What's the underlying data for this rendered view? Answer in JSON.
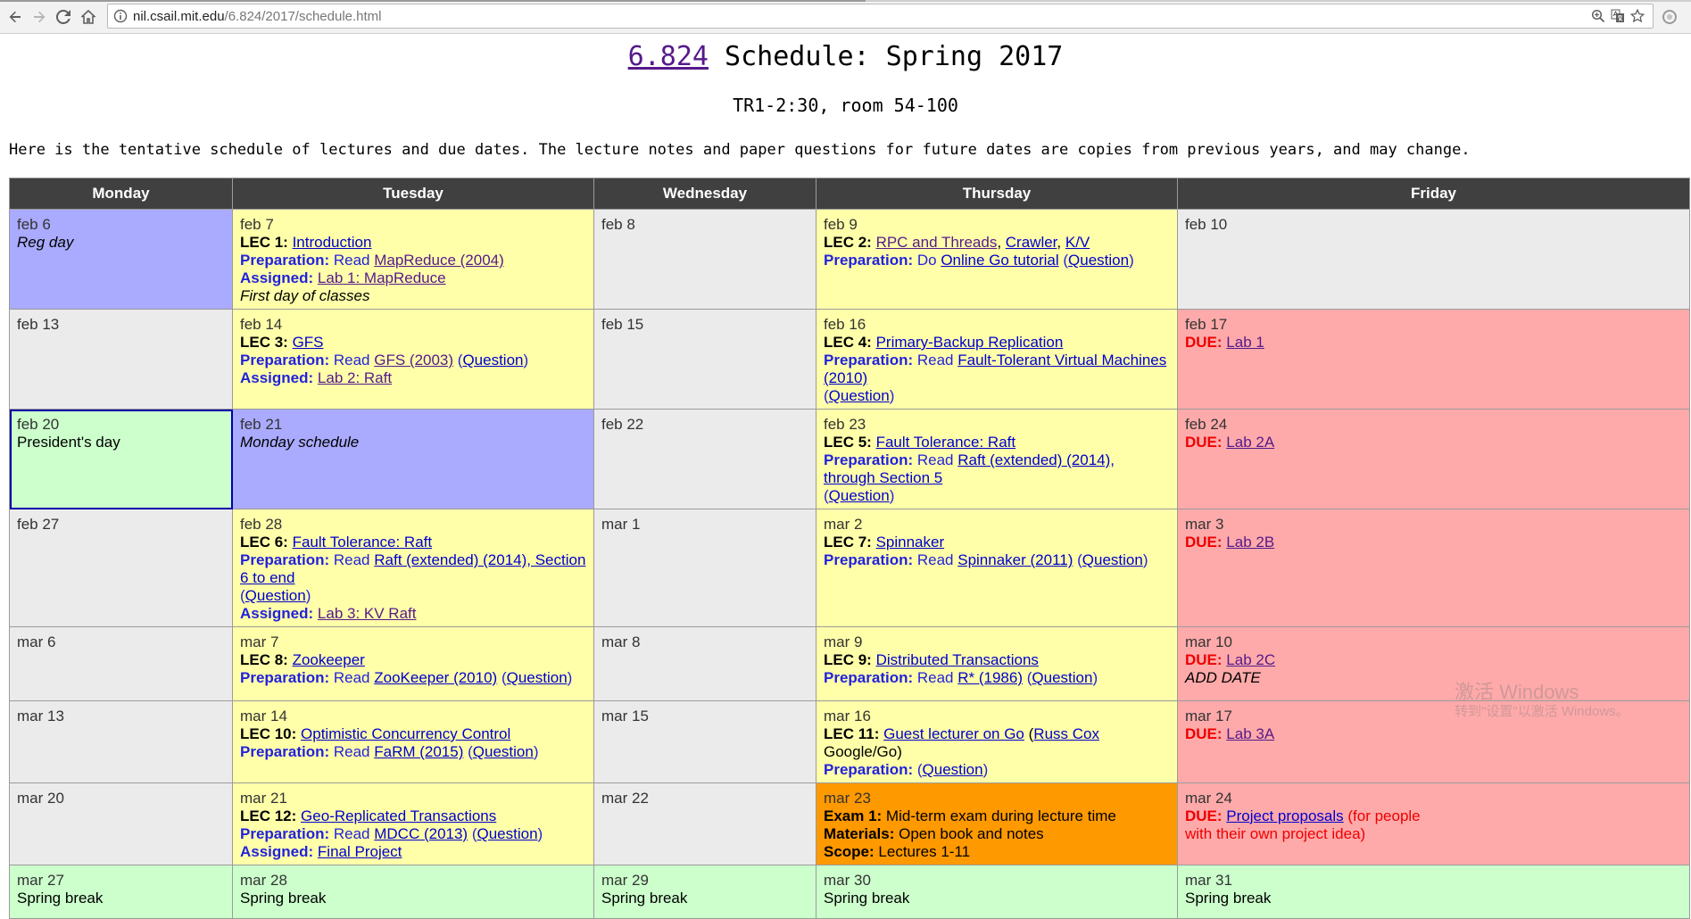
{
  "browser": {
    "url_host": "nil.csail.mit.edu",
    "url_path": "/6.824/2017/schedule.html",
    "back_icon": "back-arrow-icon",
    "forward_icon": "forward-arrow-icon",
    "reload_icon": "reload-icon",
    "home_icon": "home-icon"
  },
  "header": {
    "course_link": "6.824",
    "title_rest": " Schedule: Spring 2017",
    "subtitle": "TR1-2:30, room 54-100",
    "intro": "Here is the tentative schedule of lectures and due dates. The lecture notes and paper questions for future dates are copies from previous years, and may change."
  },
  "days": [
    "Monday",
    "Tuesday",
    "Wednesday",
    "Thursday",
    "Friday"
  ],
  "colors": {
    "header_bg": "#404040",
    "default": "#ebebeb",
    "lecture": "#ffffaa",
    "special": "#aaaaff",
    "holiday": "#ccffcc",
    "due": "#ffaaaa",
    "exam": "#ff9900"
  },
  "watermark": {
    "line1": "激活 Windows",
    "line2": "转到\"设置\"以激活 Windows。"
  },
  "weeks": [
    [
      {
        "date": "feb 6",
        "type": "special",
        "lines": [
          [
            {
              "t": "Reg day",
              "s": "it"
            }
          ]
        ]
      },
      {
        "date": "feb 7",
        "type": "lecture",
        "lines": [
          [
            {
              "t": "LEC 1: ",
              "s": "b"
            },
            {
              "t": "Introduction",
              "s": "link"
            }
          ],
          [
            {
              "t": "Preparation:",
              "s": "pb"
            },
            {
              "t": " Read ",
              "s": "p"
            },
            {
              "t": "MapReduce (2004)",
              "s": "linkv"
            }
          ],
          [
            {
              "t": "Assigned:",
              "s": "pb"
            },
            {
              "t": " ",
              "s": "p"
            },
            {
              "t": "Lab 1: MapReduce",
              "s": "linkv"
            }
          ],
          [
            {
              "t": "First day of classes",
              "s": "it"
            }
          ]
        ]
      },
      {
        "date": "feb 8",
        "type": "default",
        "lines": []
      },
      {
        "date": "feb 9",
        "type": "lecture",
        "lines": [
          [
            {
              "t": "LEC 2: ",
              "s": "b"
            },
            {
              "t": "RPC and Threads",
              "s": "linkv"
            },
            {
              "t": ", ",
              "s": "n"
            },
            {
              "t": "Crawler",
              "s": "link"
            },
            {
              "t": ", ",
              "s": "n"
            },
            {
              "t": "K/V",
              "s": "link"
            }
          ],
          [
            {
              "t": "Preparation:",
              "s": "pb"
            },
            {
              "t": " Do ",
              "s": "p"
            },
            {
              "t": "Online Go tutorial",
              "s": "link"
            },
            {
              "t": " (",
              "s": "p"
            },
            {
              "t": "Question",
              "s": "link"
            },
            {
              "t": ")",
              "s": "p"
            }
          ]
        ]
      },
      {
        "date": "feb 10",
        "type": "default",
        "lines": []
      }
    ],
    [
      {
        "date": "feb 13",
        "type": "default",
        "lines": []
      },
      {
        "date": "feb 14",
        "type": "lecture",
        "lines": [
          [
            {
              "t": "LEC 3: ",
              "s": "b"
            },
            {
              "t": "GFS",
              "s": "link"
            }
          ],
          [
            {
              "t": "Preparation:",
              "s": "pb"
            },
            {
              "t": " Read ",
              "s": "p"
            },
            {
              "t": "GFS (2003)",
              "s": "linkv"
            },
            {
              "t": " (",
              "s": "p"
            },
            {
              "t": "Question",
              "s": "link"
            },
            {
              "t": ")",
              "s": "p"
            }
          ],
          [
            {
              "t": "Assigned:",
              "s": "pb"
            },
            {
              "t": " ",
              "s": "p"
            },
            {
              "t": "Lab 2: Raft",
              "s": "linkv"
            }
          ]
        ]
      },
      {
        "date": "feb 15",
        "type": "default",
        "lines": []
      },
      {
        "date": "feb 16",
        "type": "lecture",
        "lines": [
          [
            {
              "t": "LEC 4: ",
              "s": "b"
            },
            {
              "t": "Primary-Backup Replication",
              "s": "link"
            }
          ],
          [
            {
              "t": "Preparation:",
              "s": "pb"
            },
            {
              "t": " Read ",
              "s": "p"
            },
            {
              "t": "Fault-Tolerant Virtual Machines (2010)",
              "s": "link"
            }
          ],
          [
            {
              "t": "(",
              "s": "p"
            },
            {
              "t": "Question",
              "s": "link"
            },
            {
              "t": ")",
              "s": "p"
            }
          ]
        ]
      },
      {
        "date": "feb 17",
        "type": "due",
        "lines": [
          [
            {
              "t": "DUE:",
              "s": "db"
            },
            {
              "t": " ",
              "s": "d"
            },
            {
              "t": "Lab 1",
              "s": "linkv"
            }
          ]
        ]
      }
    ],
    [
      {
        "date": "feb 20",
        "type": "holiday",
        "selected": true,
        "lines": [
          [
            {
              "t": "President's day",
              "s": "n"
            }
          ]
        ]
      },
      {
        "date": "feb 21",
        "type": "special",
        "lines": [
          [
            {
              "t": "Monday schedule",
              "s": "it"
            }
          ]
        ]
      },
      {
        "date": "feb 22",
        "type": "default",
        "lines": []
      },
      {
        "date": "feb 23",
        "type": "lecture",
        "lines": [
          [
            {
              "t": "LEC 5: ",
              "s": "b"
            },
            {
              "t": "Fault Tolerance: Raft",
              "s": "link"
            }
          ],
          [
            {
              "t": "Preparation:",
              "s": "pb"
            },
            {
              "t": " Read ",
              "s": "p"
            },
            {
              "t": "Raft (extended) (2014), through Section 5",
              "s": "link"
            }
          ],
          [
            {
              "t": "(",
              "s": "p"
            },
            {
              "t": "Question",
              "s": "link"
            },
            {
              "t": ")",
              "s": "p"
            }
          ]
        ]
      },
      {
        "date": "feb 24",
        "type": "due",
        "lines": [
          [
            {
              "t": "DUE:",
              "s": "db"
            },
            {
              "t": " ",
              "s": "d"
            },
            {
              "t": "Lab 2A",
              "s": "linkv"
            }
          ]
        ]
      }
    ],
    [
      {
        "date": "feb 27",
        "type": "default",
        "lines": []
      },
      {
        "date": "feb 28",
        "type": "lecture",
        "lines": [
          [
            {
              "t": "LEC 6: ",
              "s": "b"
            },
            {
              "t": "Fault Tolerance: Raft",
              "s": "link"
            }
          ],
          [
            {
              "t": "Preparation:",
              "s": "pb"
            },
            {
              "t": " Read ",
              "s": "p"
            },
            {
              "t": "Raft (extended) (2014), Section 6 to end",
              "s": "link"
            }
          ],
          [
            {
              "t": "(",
              "s": "p"
            },
            {
              "t": "Question",
              "s": "link"
            },
            {
              "t": ")",
              "s": "p"
            }
          ],
          [
            {
              "t": "Assigned:",
              "s": "pb"
            },
            {
              "t": " ",
              "s": "p"
            },
            {
              "t": "Lab 3: KV Raft",
              "s": "linkv"
            }
          ]
        ]
      },
      {
        "date": "mar 1",
        "type": "default",
        "lines": []
      },
      {
        "date": "mar 2",
        "type": "lecture",
        "lines": [
          [
            {
              "t": "LEC 7: ",
              "s": "b"
            },
            {
              "t": "Spinnaker",
              "s": "link"
            }
          ],
          [
            {
              "t": "Preparation:",
              "s": "pb"
            },
            {
              "t": " Read ",
              "s": "p"
            },
            {
              "t": "Spinnaker (2011)",
              "s": "link"
            },
            {
              "t": " (",
              "s": "p"
            },
            {
              "t": "Question",
              "s": "link"
            },
            {
              "t": ")",
              "s": "p"
            }
          ]
        ]
      },
      {
        "date": "mar 3",
        "type": "due",
        "lines": [
          [
            {
              "t": "DUE:",
              "s": "db"
            },
            {
              "t": " ",
              "s": "d"
            },
            {
              "t": "Lab 2B",
              "s": "linkv"
            }
          ]
        ]
      }
    ],
    [
      {
        "date": "mar 6",
        "type": "default",
        "lines": []
      },
      {
        "date": "mar 7",
        "type": "lecture",
        "lines": [
          [
            {
              "t": "LEC 8: ",
              "s": "b"
            },
            {
              "t": "Zookeeper",
              "s": "link"
            }
          ],
          [
            {
              "t": "Preparation:",
              "s": "pb"
            },
            {
              "t": " Read ",
              "s": "p"
            },
            {
              "t": "ZooKeeper (2010)",
              "s": "link"
            },
            {
              "t": " (",
              "s": "p"
            },
            {
              "t": "Question",
              "s": "link"
            },
            {
              "t": ")",
              "s": "p"
            }
          ]
        ]
      },
      {
        "date": "mar 8",
        "type": "default",
        "lines": []
      },
      {
        "date": "mar 9",
        "type": "lecture",
        "lines": [
          [
            {
              "t": "LEC 9: ",
              "s": "b"
            },
            {
              "t": "Distributed Transactions",
              "s": "link"
            }
          ],
          [
            {
              "t": "Preparation:",
              "s": "pb"
            },
            {
              "t": " Read ",
              "s": "p"
            },
            {
              "t": "R* (1986)",
              "s": "link"
            },
            {
              "t": " (",
              "s": "p"
            },
            {
              "t": "Question",
              "s": "link"
            },
            {
              "t": ")",
              "s": "p"
            }
          ]
        ]
      },
      {
        "date": "mar 10",
        "type": "due",
        "lines": [
          [
            {
              "t": "DUE:",
              "s": "db"
            },
            {
              "t": " ",
              "s": "d"
            },
            {
              "t": "Lab 2C",
              "s": "linkv"
            }
          ],
          [
            {
              "t": "ADD DATE",
              "s": "it"
            }
          ]
        ]
      }
    ],
    [
      {
        "date": "mar 13",
        "type": "default",
        "lines": []
      },
      {
        "date": "mar 14",
        "type": "lecture",
        "lines": [
          [
            {
              "t": "LEC 10: ",
              "s": "b"
            },
            {
              "t": "Optimistic Concurrency Control",
              "s": "link"
            }
          ],
          [
            {
              "t": "Preparation:",
              "s": "pb"
            },
            {
              "t": " Read ",
              "s": "p"
            },
            {
              "t": "FaRM (2015)",
              "s": "link"
            },
            {
              "t": " (",
              "s": "p"
            },
            {
              "t": "Question",
              "s": "link"
            },
            {
              "t": ")",
              "s": "p"
            }
          ]
        ]
      },
      {
        "date": "mar 15",
        "type": "default",
        "lines": []
      },
      {
        "date": "mar 16",
        "type": "lecture",
        "lines": [
          [
            {
              "t": "LEC 11: ",
              "s": "b"
            },
            {
              "t": "Guest lecturer on Go",
              "s": "link"
            },
            {
              "t": " (",
              "s": "n"
            },
            {
              "t": "Russ Cox",
              "s": "link"
            },
            {
              "t": " Google/Go)",
              "s": "n"
            }
          ],
          [
            {
              "t": "Preparation:",
              "s": "pb"
            },
            {
              "t": " (",
              "s": "p"
            },
            {
              "t": "Question",
              "s": "link"
            },
            {
              "t": ")",
              "s": "p"
            }
          ]
        ]
      },
      {
        "date": "mar 17",
        "type": "due",
        "lines": [
          [
            {
              "t": "DUE:",
              "s": "db"
            },
            {
              "t": " ",
              "s": "d"
            },
            {
              "t": "Lab 3A",
              "s": "linkv"
            }
          ]
        ]
      }
    ],
    [
      {
        "date": "mar 20",
        "type": "default",
        "lines": []
      },
      {
        "date": "mar 21",
        "type": "lecture",
        "lines": [
          [
            {
              "t": "LEC 12: ",
              "s": "b"
            },
            {
              "t": "Geo-Replicated Transactions",
              "s": "link"
            }
          ],
          [
            {
              "t": "Preparation:",
              "s": "pb"
            },
            {
              "t": " Read ",
              "s": "p"
            },
            {
              "t": "MDCC (2013)",
              "s": "link"
            },
            {
              "t": " (",
              "s": "p"
            },
            {
              "t": "Question",
              "s": "link"
            },
            {
              "t": ")",
              "s": "p"
            }
          ],
          [
            {
              "t": "Assigned:",
              "s": "pb"
            },
            {
              "t": " ",
              "s": "p"
            },
            {
              "t": "Final Project",
              "s": "link"
            }
          ]
        ]
      },
      {
        "date": "mar 22",
        "type": "default",
        "lines": []
      },
      {
        "date": "mar 23",
        "type": "exam",
        "lines": [
          [
            {
              "t": "Exam 1:",
              "s": "b"
            },
            {
              "t": " Mid-term exam during lecture time",
              "s": "n"
            }
          ],
          [
            {
              "t": "Materials:",
              "s": "b"
            },
            {
              "t": " Open book and notes",
              "s": "n"
            }
          ],
          [
            {
              "t": "Scope:",
              "s": "b"
            },
            {
              "t": " Lectures 1-11",
              "s": "n"
            }
          ]
        ]
      },
      {
        "date": "mar 24",
        "type": "due",
        "lines": [
          [
            {
              "t": "DUE:",
              "s": "db"
            },
            {
              "t": " ",
              "s": "d"
            },
            {
              "t": "Project proposals",
              "s": "link"
            },
            {
              "t": " (for people",
              "s": "d"
            }
          ],
          [
            {
              "t": "with their own project idea)",
              "s": "d"
            }
          ]
        ]
      }
    ],
    [
      {
        "date": "mar 27",
        "type": "holiday",
        "lines": [
          [
            {
              "t": "Spring break",
              "s": "n"
            }
          ]
        ]
      },
      {
        "date": "mar 28",
        "type": "holiday",
        "lines": [
          [
            {
              "t": "Spring break",
              "s": "n"
            }
          ]
        ]
      },
      {
        "date": "mar 29",
        "type": "holiday",
        "lines": [
          [
            {
              "t": "Spring break",
              "s": "n"
            }
          ]
        ]
      },
      {
        "date": "mar 30",
        "type": "holiday",
        "lines": [
          [
            {
              "t": "Spring break",
              "s": "n"
            }
          ]
        ]
      },
      {
        "date": "mar 31",
        "type": "holiday",
        "lines": [
          [
            {
              "t": "Spring break",
              "s": "n"
            }
          ]
        ]
      }
    ]
  ]
}
